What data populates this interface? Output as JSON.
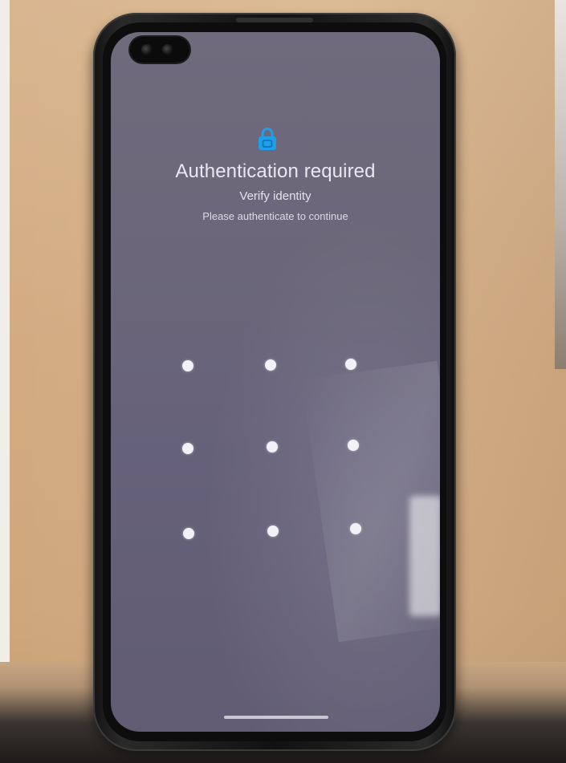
{
  "lock_screen": {
    "title": "Authentication required",
    "subtitle": "Verify identity",
    "description": "Please authenticate to continue",
    "accent_color": "#1f9fe8",
    "lock_icon": "lock-icon"
  },
  "pattern": {
    "rows": 3,
    "cols": 3,
    "dot_color": "#f2f1f5"
  }
}
